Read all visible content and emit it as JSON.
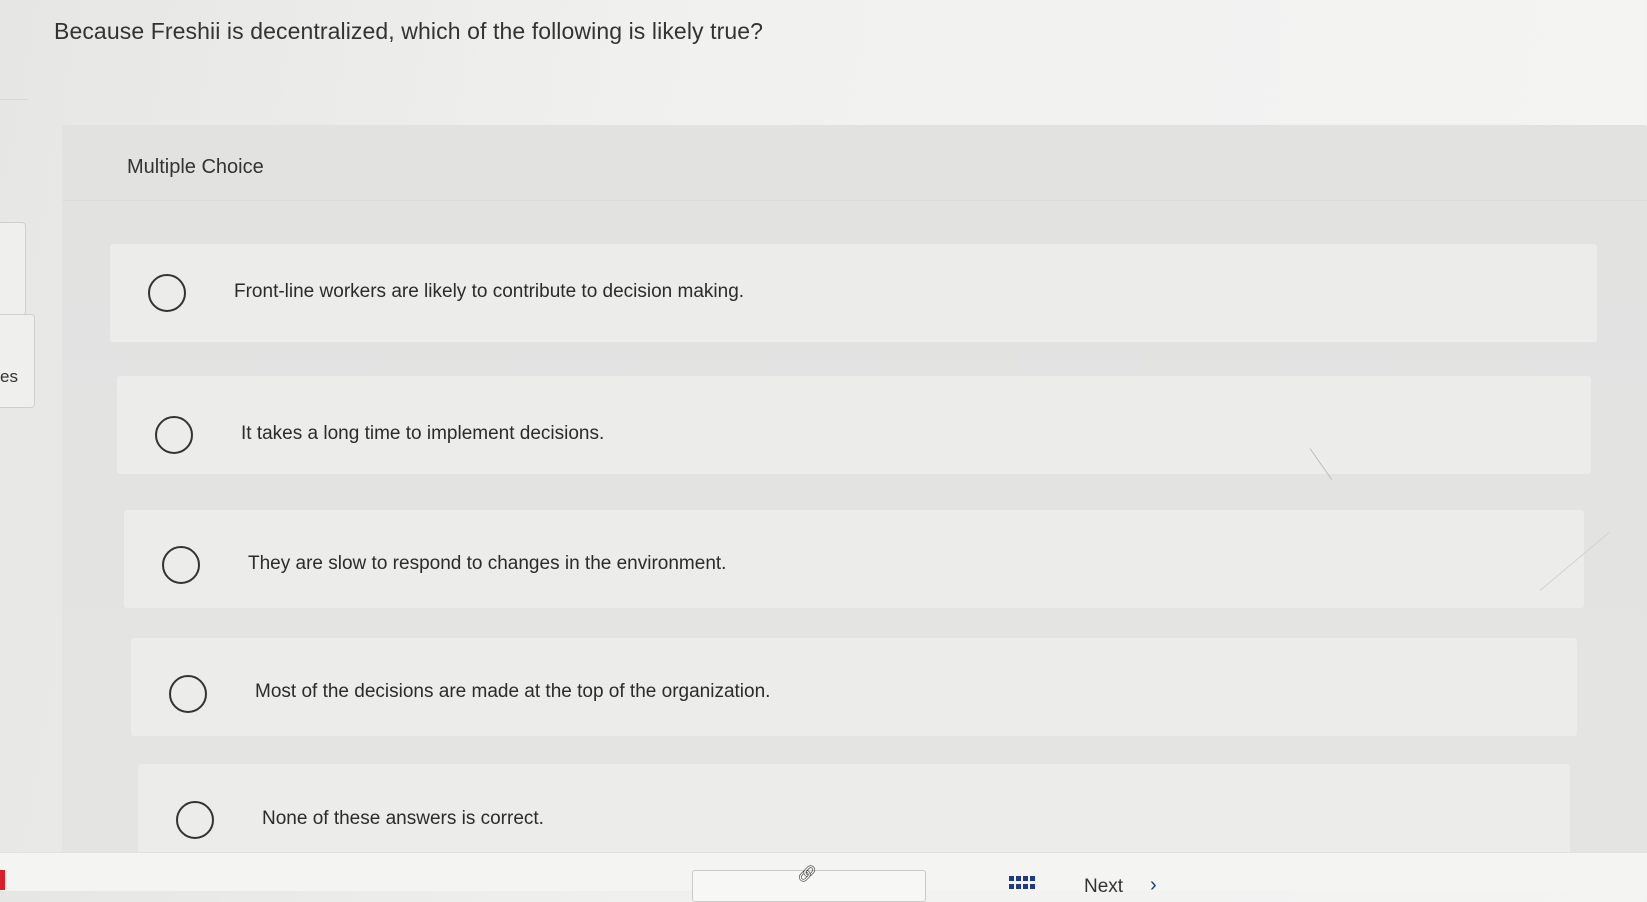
{
  "question": {
    "text": "Because Freshii is decentralized, which of the following is likely true?"
  },
  "sidebar": {
    "stub_text": "es"
  },
  "multiple_choice": {
    "label": "Multiple Choice",
    "options": [
      {
        "text": "Front-line workers are likely to contribute to decision making.",
        "selected": false
      },
      {
        "text": "It takes a long time to implement decisions.",
        "selected": false
      },
      {
        "text": "They are slow to respond to changes in the environment.",
        "selected": false
      },
      {
        "text": "Most of the decisions are made at the top of the organization.",
        "selected": false
      },
      {
        "text": "None of these answers is correct.",
        "selected": false
      }
    ]
  },
  "footer": {
    "link_icon": "link-icon",
    "grid_icon": "grid-icon",
    "next_label": "Next",
    "next_icon": "chevron-right-icon"
  },
  "colors": {
    "accent": "#1f3a8a",
    "brand_red": "#d2232a"
  }
}
